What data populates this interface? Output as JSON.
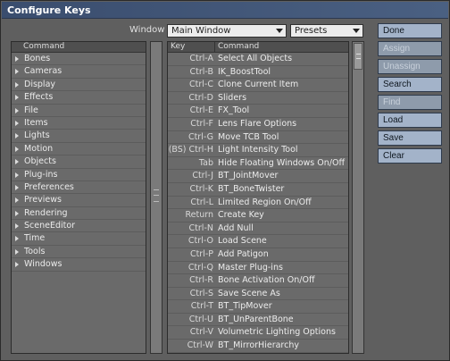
{
  "window": {
    "title": "Configure Keys"
  },
  "toolbar": {
    "window_label": "Window",
    "window_value": "Main Window",
    "presets_value": "Presets"
  },
  "left": {
    "header": "Command",
    "items": [
      "Bones",
      "Cameras",
      "Display",
      "Effects",
      "File",
      "Items",
      "Lights",
      "Motion",
      "Objects",
      "Plug-ins",
      "Preferences",
      "Previews",
      "Rendering",
      "SceneEditor",
      "Time",
      "Tools",
      "Windows"
    ]
  },
  "right": {
    "key_header": "Key",
    "command_header": "Command",
    "rows": [
      {
        "key": "Ctrl-A",
        "cmd": "Select All Objects"
      },
      {
        "key": "Ctrl-B",
        "cmd": "IK_BoostTool"
      },
      {
        "key": "Ctrl-C",
        "cmd": "Clone Current Item"
      },
      {
        "key": "Ctrl-D",
        "cmd": "Sliders"
      },
      {
        "key": "Ctrl-E",
        "cmd": "FX_Tool"
      },
      {
        "key": "Ctrl-F",
        "cmd": "Lens Flare Options"
      },
      {
        "key": "Ctrl-G",
        "cmd": "Move TCB Tool"
      },
      {
        "key": "(BS) Ctrl-H",
        "cmd": "Light Intensity Tool"
      },
      {
        "key": "Tab",
        "cmd": "Hide Floating Windows On/Off"
      },
      {
        "key": "Ctrl-J",
        "cmd": "BT_JointMover"
      },
      {
        "key": "Ctrl-K",
        "cmd": "BT_BoneTwister"
      },
      {
        "key": "Ctrl-L",
        "cmd": "Limited Region On/Off"
      },
      {
        "key": "Return",
        "cmd": "Create Key"
      },
      {
        "key": "Ctrl-N",
        "cmd": "Add Null"
      },
      {
        "key": "Ctrl-O",
        "cmd": "Load Scene"
      },
      {
        "key": "Ctrl-P",
        "cmd": "Add Patigon"
      },
      {
        "key": "Ctrl-Q",
        "cmd": "Master Plug-ins"
      },
      {
        "key": "Ctrl-R",
        "cmd": "Bone Activation On/Off"
      },
      {
        "key": "Ctrl-S",
        "cmd": "Save Scene As"
      },
      {
        "key": "Ctrl-T",
        "cmd": "BT_TipMover"
      },
      {
        "key": "Ctrl-U",
        "cmd": "BT_UnParentBone"
      },
      {
        "key": "Ctrl-V",
        "cmd": "Volumetric Lighting Options"
      },
      {
        "key": "Ctrl-W",
        "cmd": "BT_MirrorHierarchy"
      }
    ]
  },
  "buttons": {
    "done": "Done",
    "assign": "Assign",
    "unassign": "Unassign",
    "search": "Search",
    "find": "Find",
    "load": "Load",
    "save": "Save",
    "clear": "Clear"
  }
}
